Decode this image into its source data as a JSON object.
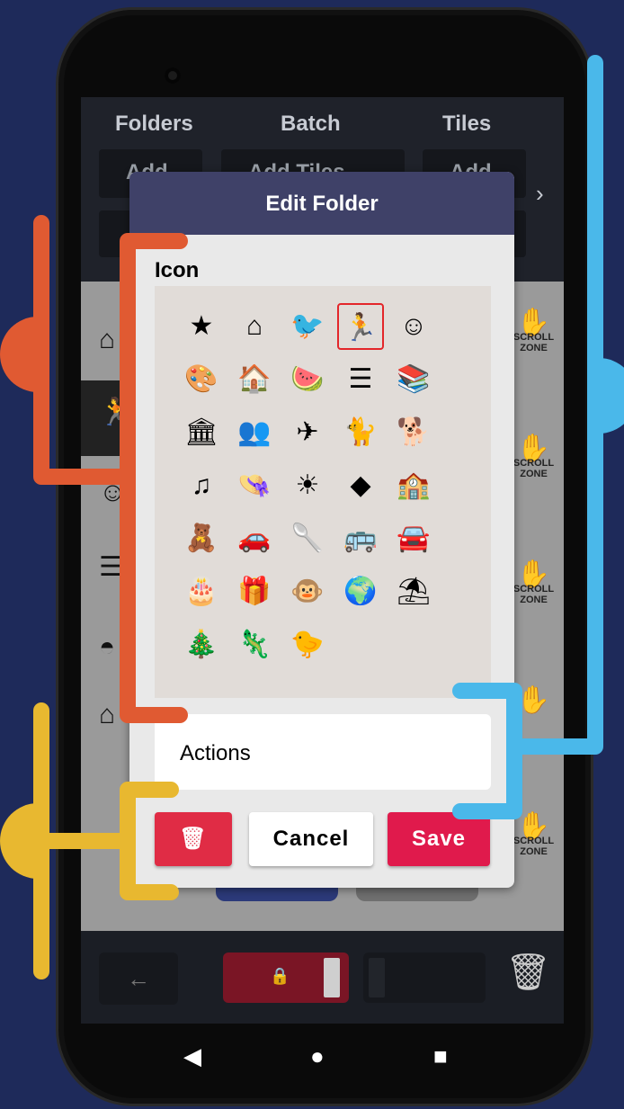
{
  "app": {
    "tabs": [
      "Folders",
      "Batch",
      "Tiles"
    ],
    "top_buttons": [
      "Add",
      "Add Tiles",
      "Add"
    ],
    "scroll_zone_label": [
      "SCROLL",
      "ZONE"
    ]
  },
  "dialog": {
    "title": "Edit Folder",
    "icon_section_label": "Icon",
    "actions_label": "Actions",
    "cancel_label": "Cancel",
    "save_label": "Save"
  },
  "icons": [
    {
      "name": "star-icon",
      "glyph": "★",
      "selected": false
    },
    {
      "name": "house-icon",
      "glyph": "⌂",
      "selected": false
    },
    {
      "name": "bird-icon",
      "glyph": "🐦",
      "selected": false
    },
    {
      "name": "running-person-icon",
      "glyph": "🏃",
      "selected": true
    },
    {
      "name": "smiley-icon",
      "glyph": "☺",
      "selected": false
    },
    {
      "name": "palette-icon",
      "glyph": "🎨",
      "selected": false
    },
    {
      "name": "home-icon",
      "glyph": "🏠",
      "selected": false
    },
    {
      "name": "watermelon-icon",
      "glyph": "🍉",
      "selected": false
    },
    {
      "name": "layered-cake-icon",
      "glyph": "☰",
      "selected": false
    },
    {
      "name": "books-icon",
      "glyph": "📚",
      "selected": false
    },
    {
      "name": "museum-icon",
      "glyph": "🏛",
      "selected": false
    },
    {
      "name": "people-group-icon",
      "glyph": "👥",
      "selected": false
    },
    {
      "name": "airplane-icon",
      "glyph": "✈",
      "selected": false
    },
    {
      "name": "cat-icon",
      "glyph": "🐈",
      "selected": false
    },
    {
      "name": "dog-jumping-icon",
      "glyph": "🐕",
      "selected": false
    },
    {
      "name": "music-note-icon",
      "glyph": "♫",
      "selected": false
    },
    {
      "name": "hat-icon",
      "glyph": "👒",
      "selected": false
    },
    {
      "name": "sun-icon",
      "glyph": "☀",
      "selected": false
    },
    {
      "name": "shapes-icon",
      "glyph": "◆",
      "selected": false
    },
    {
      "name": "school-icon",
      "glyph": "🏫",
      "selected": false
    },
    {
      "name": "teddy-bear-icon",
      "glyph": "🧸",
      "selected": false
    },
    {
      "name": "toy-car-icon",
      "glyph": "🚗",
      "selected": false
    },
    {
      "name": "spoon-icon",
      "glyph": "🥄",
      "selected": false
    },
    {
      "name": "bus-icon",
      "glyph": "🚌",
      "selected": false
    },
    {
      "name": "car-icon",
      "glyph": "🚘",
      "selected": false
    },
    {
      "name": "birthday-cake-icon",
      "glyph": "🎂",
      "selected": false
    },
    {
      "name": "gift-icon",
      "glyph": "🎁",
      "selected": false
    },
    {
      "name": "monkey-icon",
      "glyph": "🐵",
      "selected": false
    },
    {
      "name": "globe-icon",
      "glyph": "🌍",
      "selected": false
    },
    {
      "name": "beach-umbrella-icon",
      "glyph": "⛱",
      "selected": false
    },
    {
      "name": "christmas-tree-icon",
      "glyph": "🎄",
      "selected": false
    },
    {
      "name": "lizard-icon",
      "glyph": "🦎",
      "selected": false
    },
    {
      "name": "bird-branch-icon",
      "glyph": "🐤",
      "selected": false
    }
  ],
  "colors": {
    "background": "#1e2a5a",
    "dialog_header": "#3f4168",
    "delete_button": "#e02c45",
    "save_button": "#e01a4c",
    "annotation_orange": "#e05a32",
    "annotation_blue": "#4ab8ea",
    "annotation_yellow": "#e8b830"
  }
}
